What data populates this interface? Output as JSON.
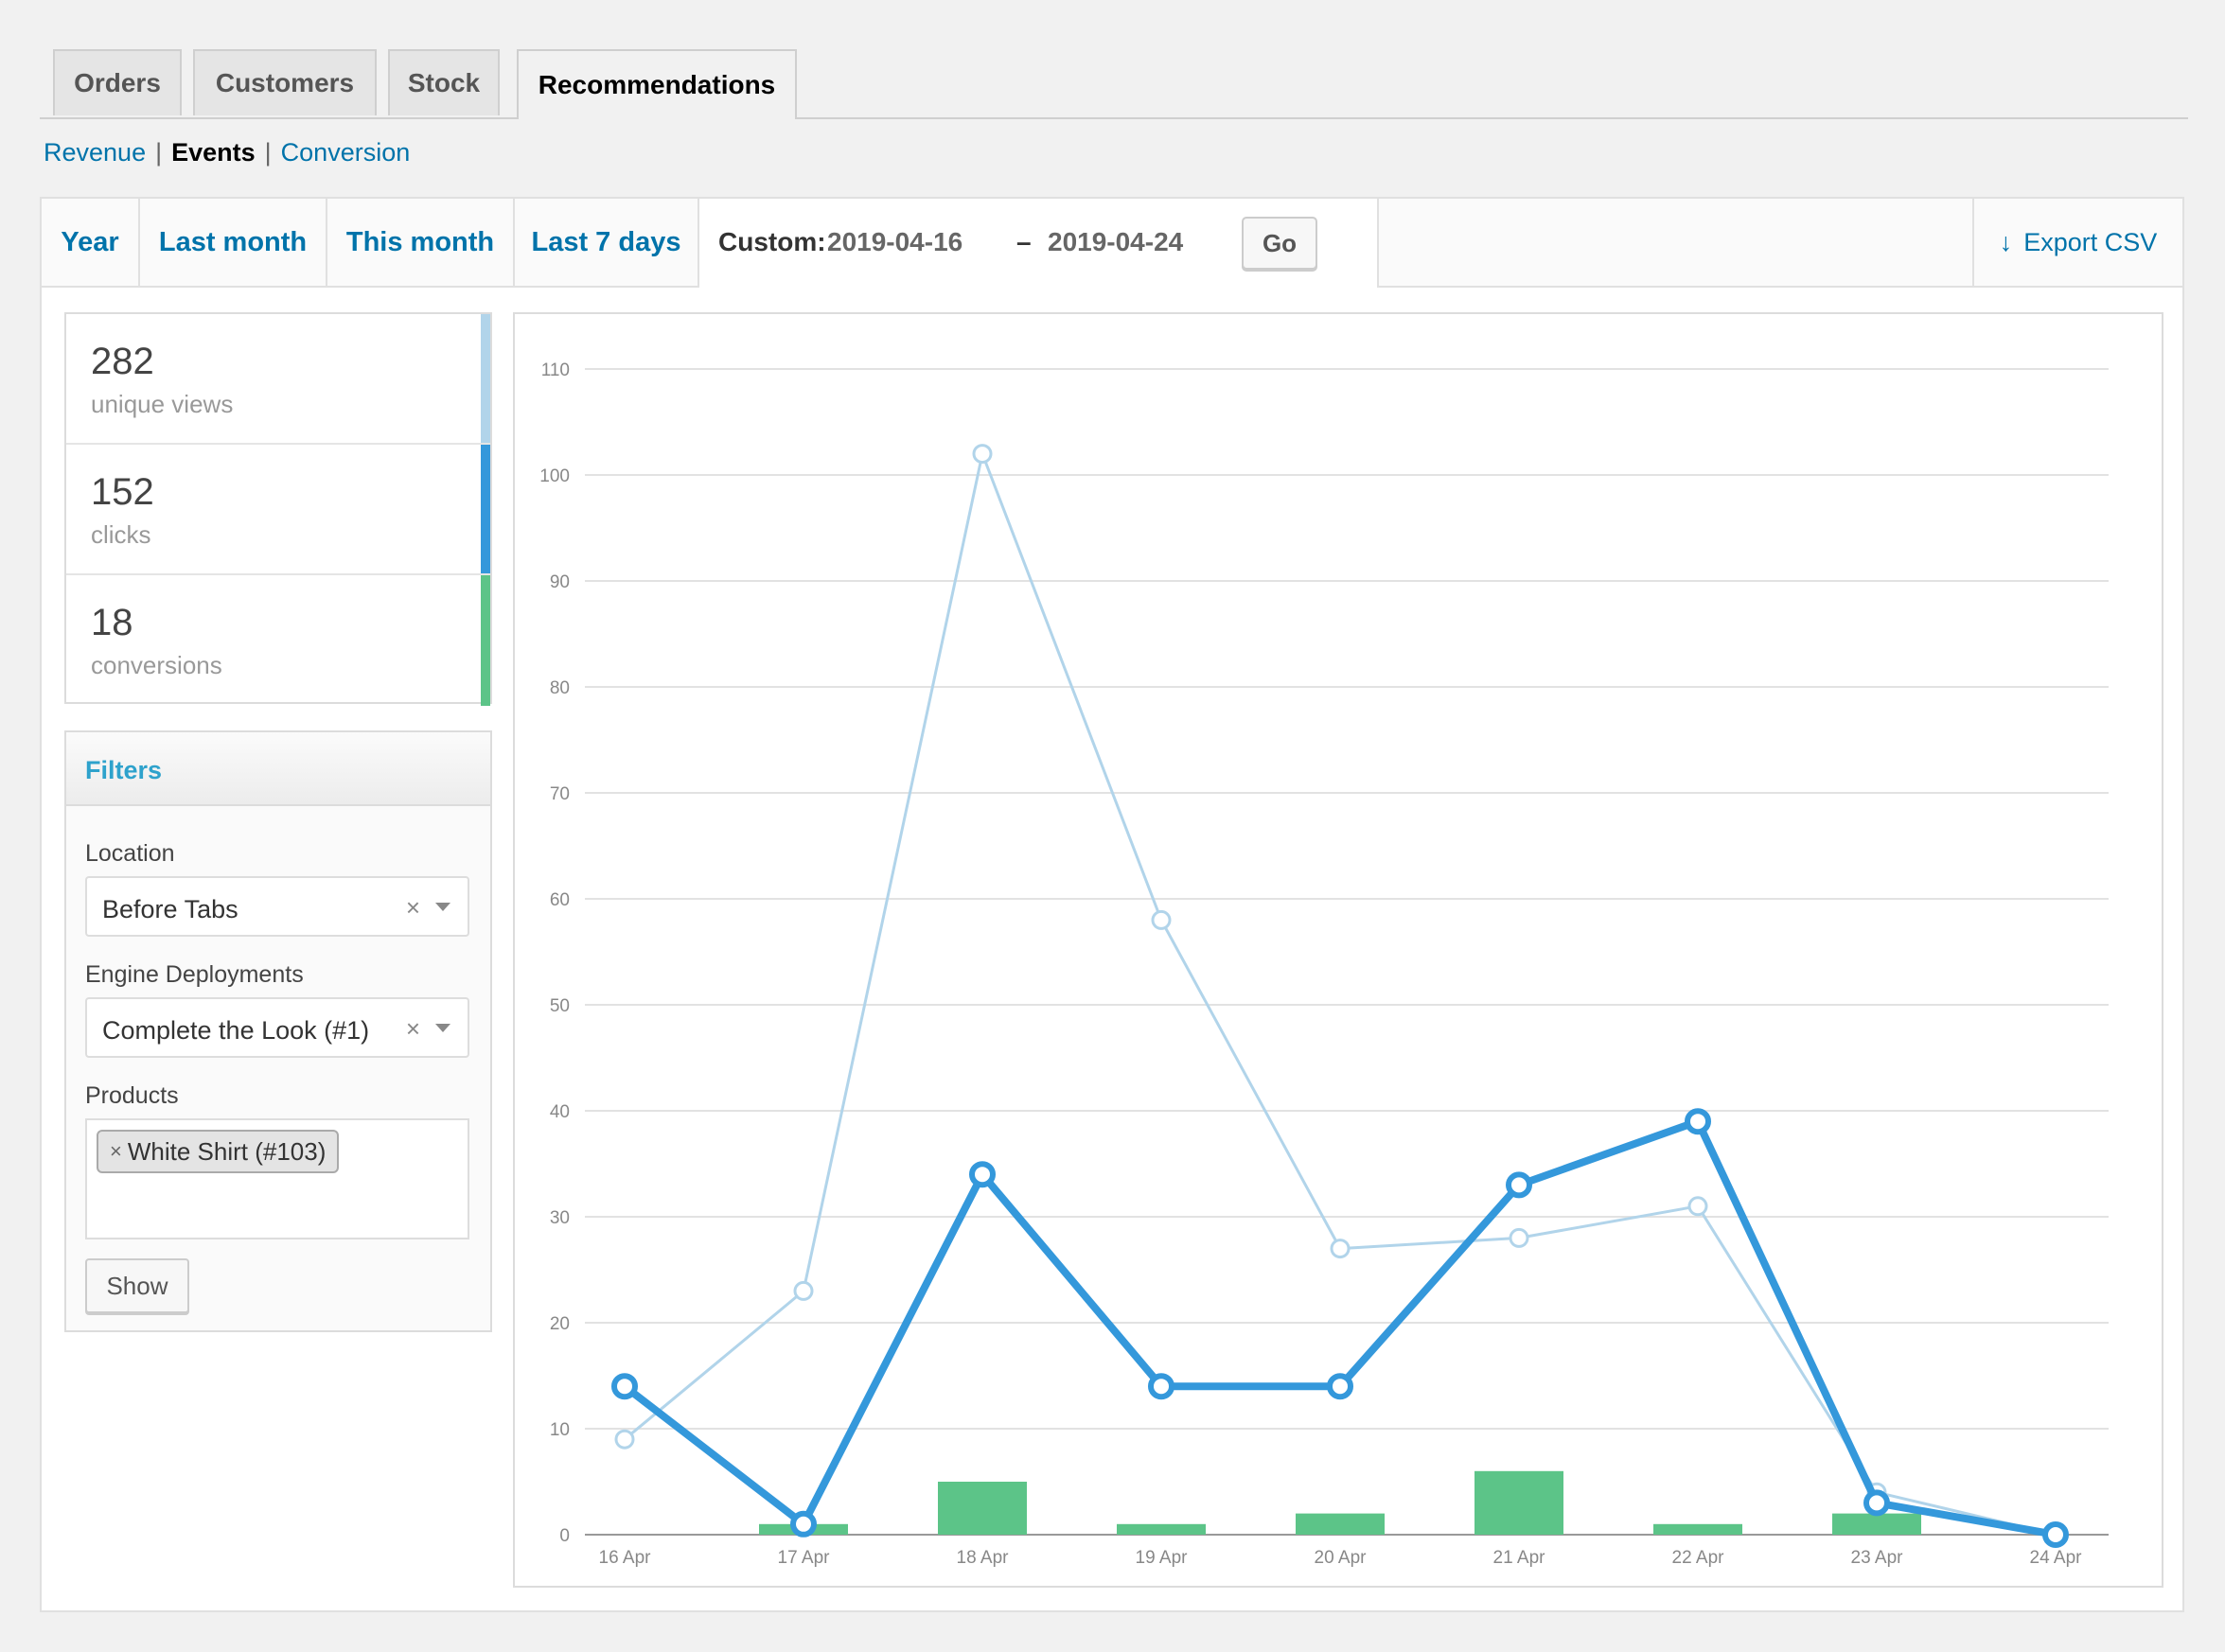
{
  "tabs": [
    "Orders",
    "Customers",
    "Stock",
    "Recommendations"
  ],
  "subnav": {
    "revenue": "Revenue",
    "events": "Events",
    "conversion": "Conversion",
    "sep": "|"
  },
  "ranges": {
    "year": "Year",
    "last_month": "Last month",
    "this_month": "This month",
    "last_7": "Last 7 days",
    "custom_label": "Custom:",
    "start": "2019-04-16",
    "dash": "–",
    "end": "2019-04-24",
    "go": "Go",
    "export": "Export CSV",
    "export_icon": "↓"
  },
  "legend": [
    {
      "value": "282",
      "label": "unique views",
      "color": "#b1d4ea"
    },
    {
      "value": "152",
      "label": "clicks",
      "color": "#3498db"
    },
    {
      "value": "18",
      "label": "conversions",
      "color": "#5cc488"
    }
  ],
  "filters": {
    "title": "Filters",
    "location_label": "Location",
    "location_value": "Before Tabs",
    "engine_label": "Engine Deployments",
    "engine_value": "Complete the Look (#1)",
    "products_label": "Products",
    "product_tag": "White Shirt (#103)",
    "clear": "×",
    "show": "Show"
  },
  "chart_data": {
    "type": "line",
    "categories": [
      "16 Apr",
      "17 Apr",
      "18 Apr",
      "19 Apr",
      "20 Apr",
      "21 Apr",
      "22 Apr",
      "23 Apr",
      "24 Apr"
    ],
    "yticks": [
      0,
      10,
      20,
      30,
      40,
      50,
      60,
      70,
      80,
      90,
      100,
      110
    ],
    "ylim": [
      0,
      110
    ],
    "series": [
      {
        "name": "unique views",
        "type": "line",
        "color": "#b1d4ea",
        "values": [
          9,
          23,
          102,
          58,
          27,
          28,
          31,
          4,
          0
        ]
      },
      {
        "name": "clicks",
        "type": "line",
        "color": "#3498db",
        "values": [
          14,
          1,
          34,
          14,
          14,
          33,
          39,
          3,
          0
        ]
      },
      {
        "name": "conversions",
        "type": "bar",
        "color": "#5cc488",
        "values": [
          0,
          1,
          5,
          1,
          2,
          6,
          1,
          2,
          0
        ]
      }
    ]
  }
}
